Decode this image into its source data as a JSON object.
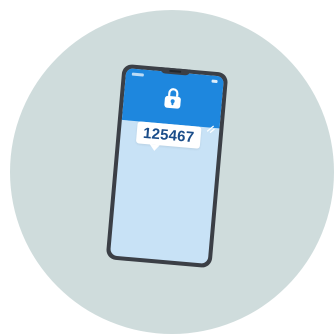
{
  "verification": {
    "code": "125467"
  },
  "icons": {
    "lock": "lock-icon",
    "sparkle": "sparkle-icon"
  },
  "colors": {
    "background_circle": "#cfdcdc",
    "phone_frame": "#3b3f46",
    "header": "#1e87de",
    "screen": "#c8e2f6",
    "code_text": "#1a4d8a"
  }
}
